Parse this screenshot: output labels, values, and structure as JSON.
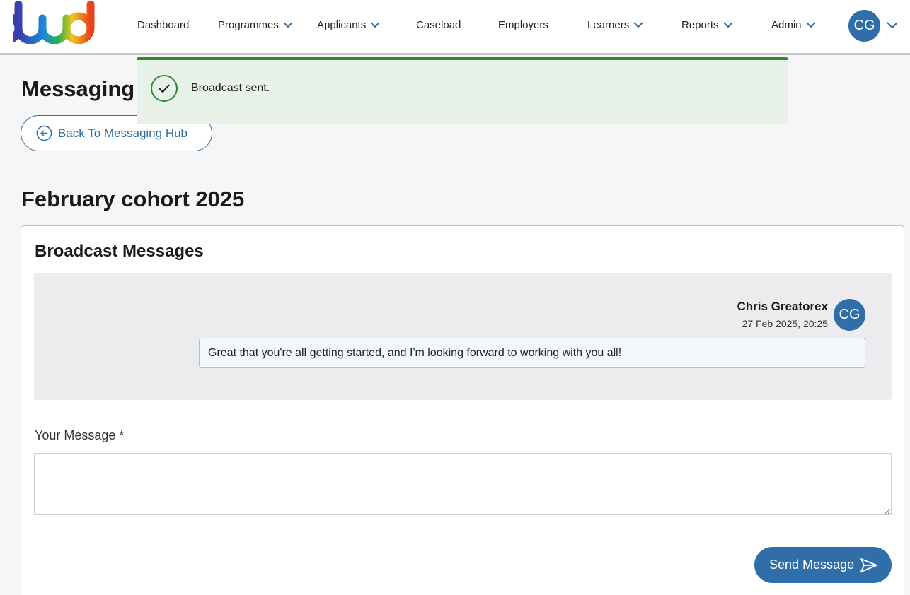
{
  "app": {
    "logo_text": "bud"
  },
  "nav": {
    "items": [
      {
        "label": "Dashboard",
        "dropdown": false
      },
      {
        "label": "Programmes",
        "dropdown": true
      },
      {
        "label": "Applicants",
        "dropdown": true
      },
      {
        "label": "Caseload",
        "dropdown": false
      },
      {
        "label": "Employers",
        "dropdown": false
      },
      {
        "label": "Learners",
        "dropdown": true
      },
      {
        "label": "Reports",
        "dropdown": true
      },
      {
        "label": "Admin",
        "dropdown": true
      }
    ],
    "user_initials": "CG"
  },
  "toast": {
    "text": "Broadcast sent.",
    "icon": "check-circle-icon"
  },
  "page": {
    "title": "Messaging Hub",
    "back_label": "Back To Messaging Hub",
    "cohort_title": "February cohort 2025"
  },
  "broadcast": {
    "title": "Broadcast Messages",
    "messages": [
      {
        "sender": "Chris Greatorex",
        "initials": "CG",
        "timestamp": "27 Feb 2025, 20:25",
        "text": "Great that you're all getting started, and I'm looking forward to working with you all!"
      }
    ]
  },
  "compose": {
    "label": "Your Message *",
    "value": "",
    "send_label": "Send Message"
  },
  "colors": {
    "primary": "#2f6ea8",
    "success": "#2e8a2e",
    "toast_bg": "#e8f2e8"
  }
}
